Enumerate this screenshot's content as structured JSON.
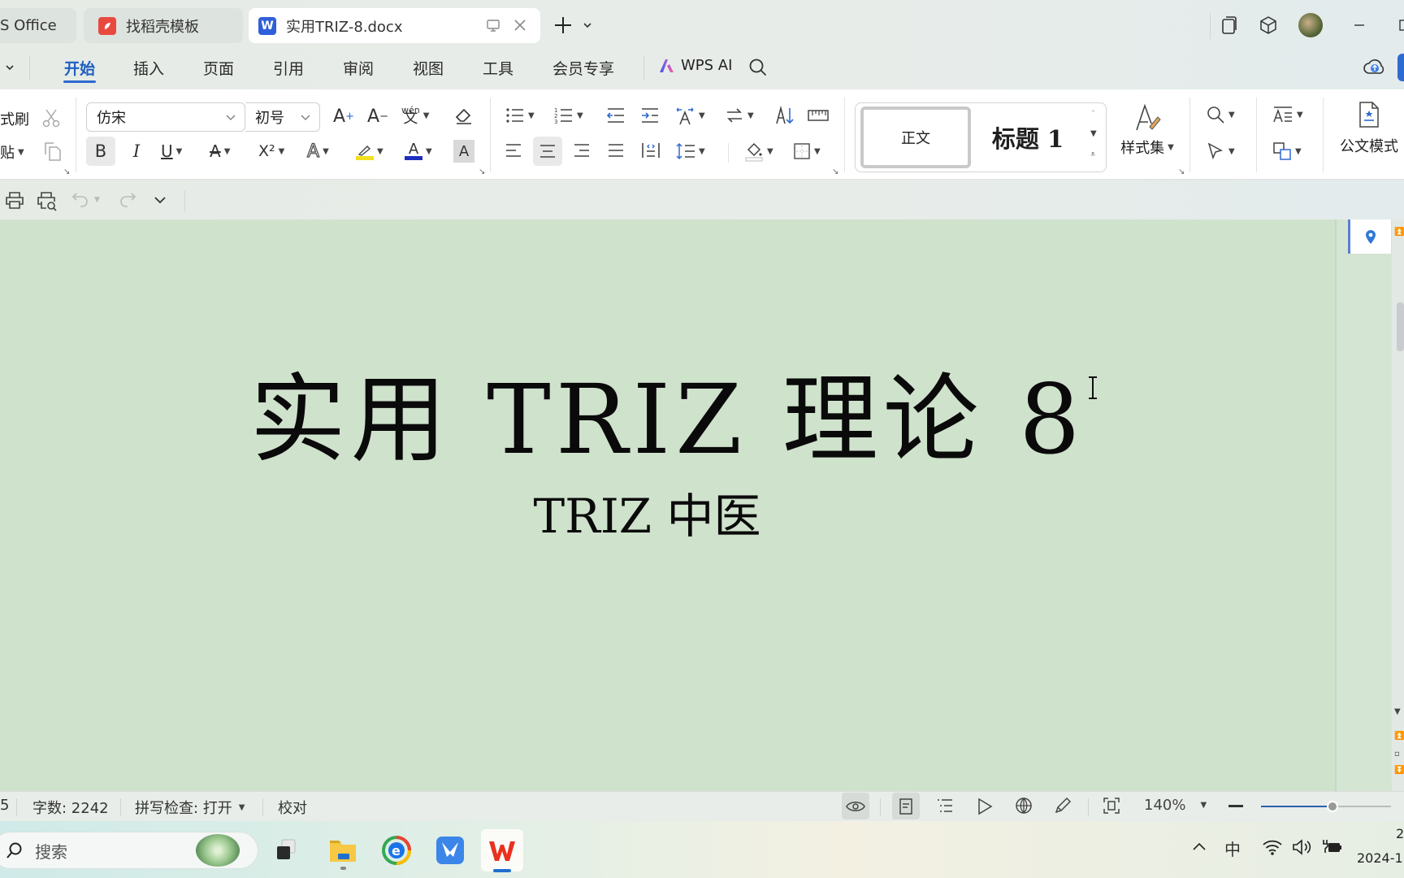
{
  "tabs": [
    {
      "label": "S Office",
      "active": false
    },
    {
      "label": "找稻壳模板",
      "icon": "docer-icon",
      "active": false
    },
    {
      "label": "实用TRIZ-8.docx",
      "icon": "wps-writer-icon",
      "active": true
    }
  ],
  "menu": {
    "items": [
      "开始",
      "插入",
      "页面",
      "引用",
      "审阅",
      "视图",
      "工具",
      "会员专享"
    ],
    "active": "开始",
    "ai_label": "WPS AI"
  },
  "ribbon": {
    "format_painter_label": "式刷",
    "paste_label": "贴",
    "font_name": "仿宋",
    "font_size": "初号",
    "phonetic_glyph": "wén",
    "styles": {
      "normal": "正文",
      "heading1": "标题 1"
    },
    "style_set_label": "样式集",
    "official_mode_label": "公文模式",
    "bold_glyph": "B",
    "italic_glyph": "I",
    "underline_glyph": "U",
    "superscript_glyph": "X²",
    "char_shading_glyph": "A",
    "font_color": "#1e2fbf",
    "highlight_color": "#f2df1e"
  },
  "document": {
    "title": "实用 TRIZ 理论 8",
    "subtitle": "TRIZ 中医",
    "background_color": "#cfe2cc"
  },
  "statusbar": {
    "page_fragment": "5",
    "word_count": "字数: 2242",
    "spell_check": "拼写检查: 打开",
    "proofread": "校对",
    "zoom": "140%",
    "zoom_level_percent": 140
  },
  "taskbar": {
    "search_placeholder": "搜索",
    "ime_label": "中",
    "clock_time": "2",
    "clock_date": "2024-1"
  }
}
